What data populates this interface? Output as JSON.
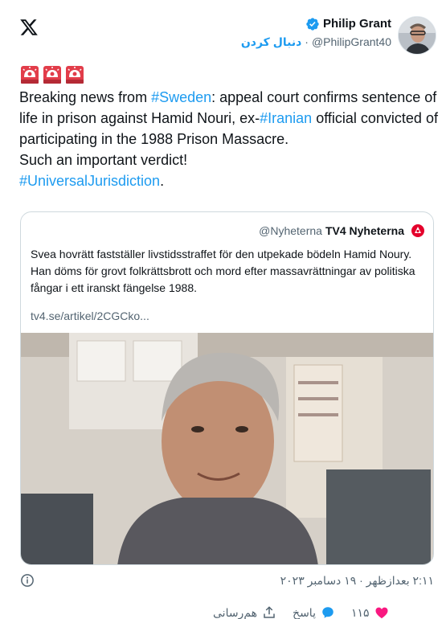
{
  "tweet": {
    "author": {
      "display_name": "Philip Grant",
      "handle": "@PhilipGrant40",
      "follow_label": "دنبال کردن",
      "separator": "·",
      "verified_color": "#1d9bf0"
    },
    "text_parts": {
      "p1": "Breaking news from ",
      "h1": "#Sweden",
      "p2": ": appeal court confirms sentence of life in prison against Hamid Nouri, ex-",
      "h2": "#Iranian",
      "p3": " official convicted of participating in the 1988 Prison Massacre.",
      "line2": "Such an important verdict!",
      "h3": "#UniversalJurisdiction",
      "p4": "."
    },
    "emojis": [
      "siren-icon",
      "siren-icon",
      "siren-icon"
    ],
    "quote": {
      "name": "TV4 Nyheterna",
      "handle": "@Nyheterna",
      "body": "Svea hovrätt fastställer livstidsstraffet för den utpekade bödeln Hamid Noury. Han döms för grovt folkrättsbrott och mord efter massavrättningar av politiska fångar i ett iranskt fängelse 1988.",
      "link": "tv4.se/artikel/2CGCko...",
      "image_alt": "photo"
    },
    "timestamp": "۲:۱۱ بعدازظهر · ۱۹ دسامبر ۲۰۲۳",
    "actions": {
      "likes": "۱۱۵",
      "reply_label": "پاسخ",
      "share_label": "هم‌رسانی"
    }
  },
  "colors": {
    "accent": "#1d9bf0",
    "like": "#f91880",
    "text": "#0f1419",
    "secondary": "#536471"
  }
}
